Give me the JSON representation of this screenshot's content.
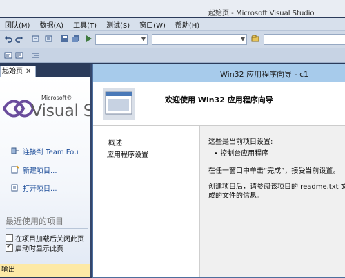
{
  "window": {
    "title": "起始页 - Microsoft Visual Studio"
  },
  "menu": [
    "团队(M)",
    "数据(A)",
    "工具(T)",
    "测试(S)",
    "窗口(W)",
    "帮助(H)"
  ],
  "start_page": {
    "tab_label": "起始页",
    "logo_small": "Microsoft®",
    "logo_big": "Visual S",
    "links": [
      "连接到 Team Fou",
      "新建项目...",
      "打开项目..."
    ],
    "recent_title": "最近使用的项目",
    "options": [
      {
        "label": "在项目加载后关闭此页",
        "checked": false
      },
      {
        "label": "启动时显示此页",
        "checked": true
      }
    ],
    "bottom_bar_label": "输出"
  },
  "wizard": {
    "title": "Win32 应用程序向导 - c1",
    "heading": "欢迎使用 Win32 应用程序向导",
    "nav": [
      "概述",
      "应用程序设置"
    ],
    "body": {
      "current_settings": "这些是当前项目设置:",
      "bullet": "控制台应用程序",
      "accept_hint": "在任一窗口中单击“完成”，接受当前设置。",
      "after_create_1": "创建项目后，请参阅该项目的 readme.txt 文",
      "after_create_2": "成的文件的信息。"
    }
  },
  "colors": {
    "wizard_title_bg": "#a7cbeb",
    "link_color": "#1e4e9a",
    "output_bar_bg": "#fde9a6"
  }
}
